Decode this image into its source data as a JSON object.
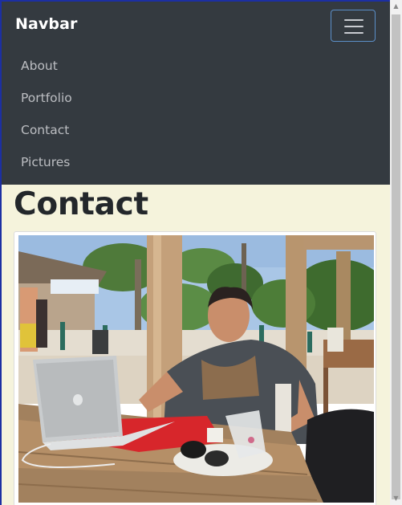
{
  "navbar": {
    "brand": "Navbar",
    "toggler_icon": "hamburger-menu-icon",
    "links": [
      "About",
      "Portfolio",
      "Contact",
      "Pictures"
    ]
  },
  "page": {
    "title": "Contact"
  },
  "photo": {
    "alt": "Man sitting at a beach bar table with a laptop"
  },
  "colors": {
    "navbar_bg": "#343a40",
    "page_bg": "#f5f3dc",
    "toggler_border": "#5b8fc9"
  }
}
